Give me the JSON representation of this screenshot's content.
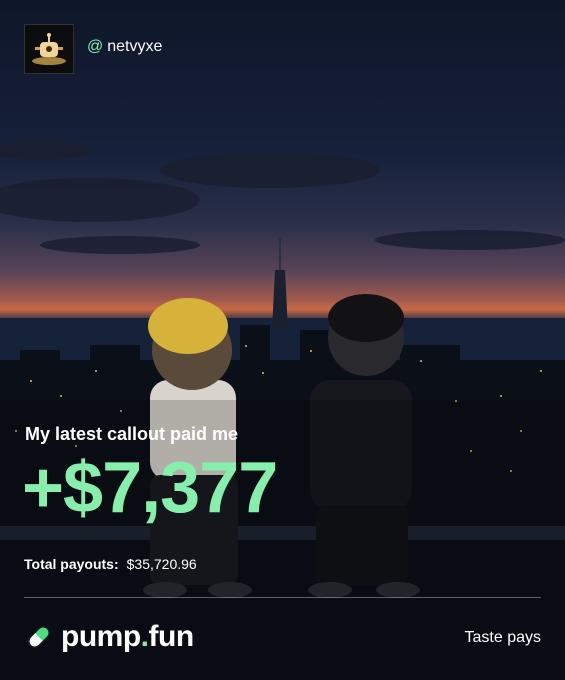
{
  "profile": {
    "at_symbol": "@",
    "username": "netvyxe",
    "avatar_icon": "robot-avatar-icon"
  },
  "callout": {
    "headline": "My latest callout paid me",
    "amount": "+$7,377"
  },
  "payouts": {
    "label": "Total payouts:",
    "value": "$35,720.96"
  },
  "brand": {
    "name_part1": "pump",
    "dot": ".",
    "name_part2": "fun",
    "logo_icon": "pill-icon",
    "tagline": "Taste pays"
  },
  "colors": {
    "accent_green": "#86efac",
    "text": "#ffffff"
  }
}
